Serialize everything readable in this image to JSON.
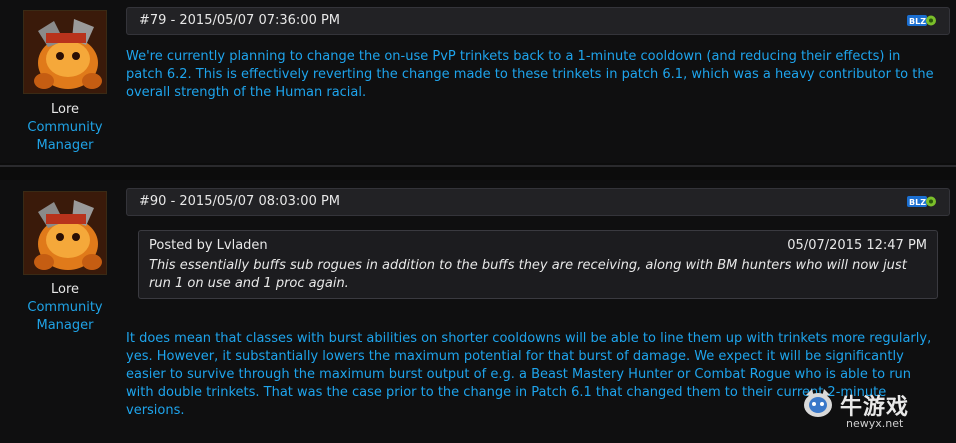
{
  "posts": [
    {
      "header": "#79 - 2015/05/07 07:36:00 PM",
      "author": {
        "name": "Lore",
        "role_line1": "Community",
        "role_line2": "Manager"
      },
      "body": "We're currently planning to change the on-use PvP trinkets back to a 1-minute cooldown (and reducing their effects) in patch 6.2. This is effectively reverting the change made to these trinkets in patch 6.1, which was a heavy contributor to the overall strength of the Human racial."
    },
    {
      "header": "#90 - 2015/05/07 08:03:00 PM",
      "author": {
        "name": "Lore",
        "role_line1": "Community",
        "role_line2": "Manager"
      },
      "quote": {
        "poster": "Posted by Lvladen",
        "date": "05/07/2015 12:47 PM",
        "text": "This essentially buffs sub rogues in addition to the buffs they are receiving, along with BM hunters who will now just run 1 on use and 1 proc again."
      },
      "body": "It does mean that classes with burst abilities on shorter cooldowns will be able to line them up with trinkets more regularly, yes. However, it substantially lowers the maximum potential for that burst of damage. We expect it will be significantly easier to survive through the maximum burst output of e.g. a Beast Mastery Hunter or Combat Rogue who is able to run with double trinkets. That was the case prior to the change in Patch 6.1 that changed them to their current 2-minute versions."
    }
  ],
  "watermark": {
    "text": "牛游戏",
    "url": "newyx.net"
  },
  "icons": {
    "blizzard": "blizzard-icon",
    "avatar": "avatar-image"
  },
  "colors": {
    "accent": "#1ea4ec",
    "header_bg": "#222225",
    "page_bg": "#0c0c0c"
  }
}
